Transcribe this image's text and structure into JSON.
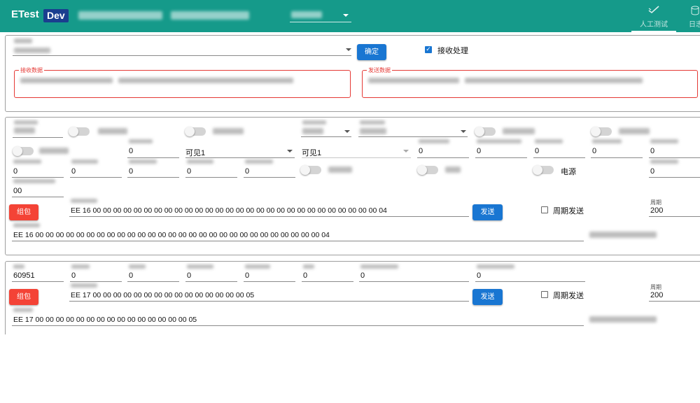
{
  "topbar": {
    "brand": "ETest",
    "brand_tag": "Dev",
    "tabs": [
      {
        "label": "人工测试",
        "icon": "check-icon"
      },
      {
        "label": "日志",
        "icon": "database-icon"
      }
    ]
  },
  "config": {
    "confirm_label": "确定",
    "receive_process_label": "接收处理",
    "receive_process_checked": true,
    "receive_data_legend": "接收数据",
    "send_data_legend": "发送数据"
  },
  "panel1": {
    "row2_values": [
      "0",
      "可见1",
      "可见1",
      "0",
      "0",
      "0",
      "0",
      "0"
    ],
    "row3_values": [
      "0",
      "0",
      "0",
      "0",
      "0"
    ],
    "power_label": "电源",
    "row3_last_value": "0",
    "row4_value": "00",
    "pack_label": "组包",
    "frame": "EE 16 00 00 00 00 00 00 00 00 00 00 00 00 00 00 00 00 00 00 00 00 00 00 00 00 00 00 00 00 04",
    "send_label": "发送",
    "periodic_label": "周期发送",
    "period_label": "周期",
    "period_value": "200",
    "result": "EE 16 00 00 00 00 00 00 00 00 00 00 00 00 00 00 00 00 00 00 00 00 00 00 00 00 00 00 00 00 04"
  },
  "panel2": {
    "row1_values": [
      "60951",
      "0",
      "0",
      "0",
      "0",
      "0",
      "0",
      "0"
    ],
    "pack_label": "组包",
    "frame": "EE 17 00 00 00 00 00 00 00 00 00 00 00 00 00 00 00 05",
    "send_label": "发送",
    "periodic_label": "周期发送",
    "period_label": "周期",
    "period_value": "200",
    "result": "EE 17 00 00 00 00 00 00 00 00 00 00 00 00 00 00 00 05"
  },
  "colors": {
    "topbar": "#159a8a",
    "primary": "#1976d2",
    "danger": "#f44336",
    "brand_tag_bg": "#1a3e8f"
  }
}
